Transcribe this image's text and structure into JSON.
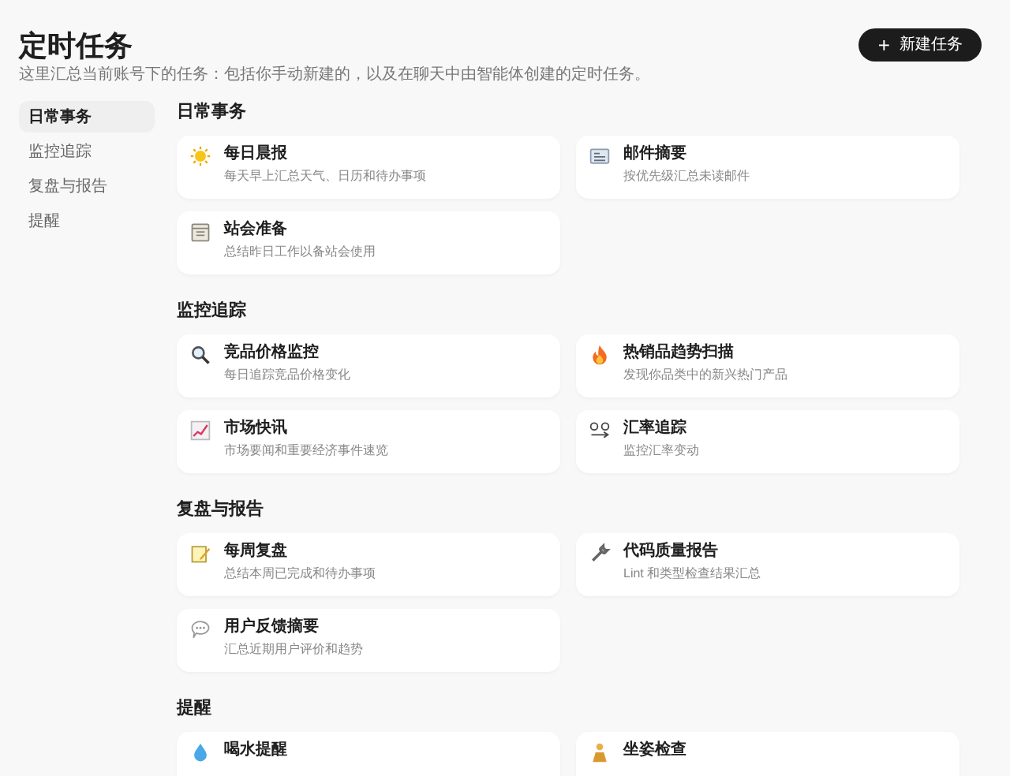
{
  "header": {
    "title": "定时任务",
    "subtitle": "这里汇总当前账号下的任务：包括你手动新建的，以及在聊天中由智能体创建的定时任务。",
    "new_button": {
      "icon": "+",
      "label": "新建任务"
    }
  },
  "sidebar": {
    "items": [
      {
        "label": "日常事务",
        "selected": true
      },
      {
        "label": "监控追踪",
        "selected": false
      },
      {
        "label": "复盘与报告",
        "selected": false
      },
      {
        "label": "提醒",
        "selected": false
      }
    ]
  },
  "sections": [
    {
      "title": "日常事务",
      "tasks": [
        {
          "title": "每日晨报",
          "description": "每天早上汇总天气、日历和待办事项"
        },
        {
          "title": "邮件摘要",
          "description": "按优先级汇总未读邮件"
        },
        {
          "title": "站会准备",
          "description": "总结昨日工作以备站会使用"
        }
      ]
    },
    {
      "title": "监控追踪",
      "tasks": [
        {
          "title": "竞品价格监控",
          "description": "每日追踪竞品价格变化"
        },
        {
          "title": "热销品趋势扫描",
          "description": "发现你品类中的新兴热门产品"
        },
        {
          "title": "市场快讯",
          "description": "市场要闻和重要经济事件速览"
        },
        {
          "title": "汇率追踪",
          "description": "监控汇率变动"
        }
      ]
    },
    {
      "title": "复盘与报告",
      "tasks": [
        {
          "title": "每周复盘",
          "description": "总结本周已完成和待办事项"
        },
        {
          "title": "代码质量报告",
          "description": "Lint 和类型检查结果汇总"
        },
        {
          "title": "用户反馈摘要",
          "description": "汇总近期用户评价和趋势"
        }
      ]
    },
    {
      "title": "提醒",
      "tasks": [
        {
          "title": "喝水提醒"
        },
        {
          "title": "坐姿检查"
        }
      ]
    }
  ]
}
